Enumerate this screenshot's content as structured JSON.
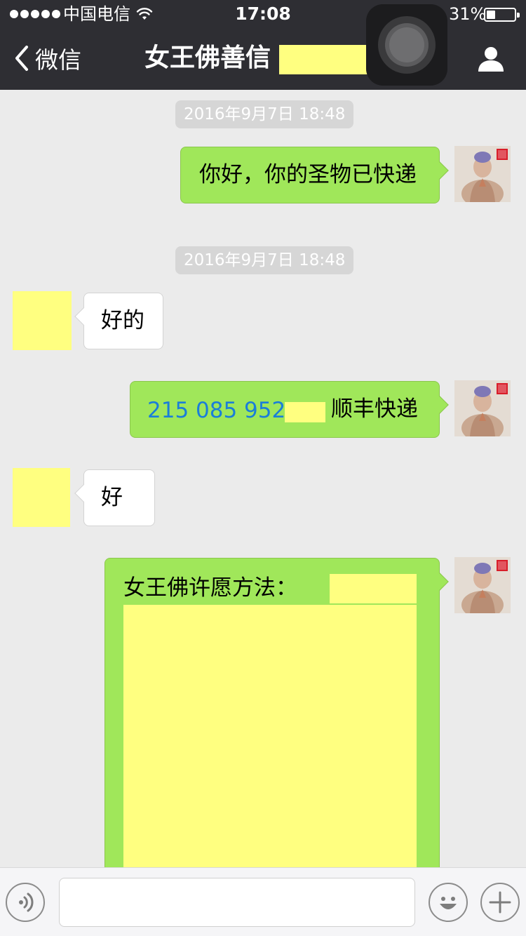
{
  "status_bar": {
    "carrier": "中国电信",
    "time": "17:08",
    "battery_percent": "31%",
    "battery_level": 0.31
  },
  "nav": {
    "back_label": "微信",
    "title": "女王佛善信"
  },
  "messages": [
    {
      "type": "timestamp",
      "text": "2016年9月7日 18:48"
    },
    {
      "type": "outgoing",
      "text": "你好，你的圣物已快递"
    },
    {
      "type": "timestamp",
      "text": "2016年9月7日 18:48"
    },
    {
      "type": "incoming",
      "text": "好的"
    },
    {
      "type": "outgoing",
      "tracking": "215 085 952",
      "suffix": "顺丰快递"
    },
    {
      "type": "incoming",
      "text": "好"
    },
    {
      "type": "outgoing",
      "text": "女王佛许愿方法："
    }
  ],
  "colors": {
    "nav_bg": "#2e2e33",
    "chat_bg": "#ebebeb",
    "outgoing_bubble": "#a0e75a",
    "incoming_bubble": "#ffffff",
    "redaction": "#ffff80",
    "link": "#1a7ed9"
  },
  "icons": {
    "back": "chevron-left-icon",
    "profile": "person-icon",
    "voice": "voice-icon",
    "emoji": "emoji-icon",
    "add": "plus-icon"
  }
}
